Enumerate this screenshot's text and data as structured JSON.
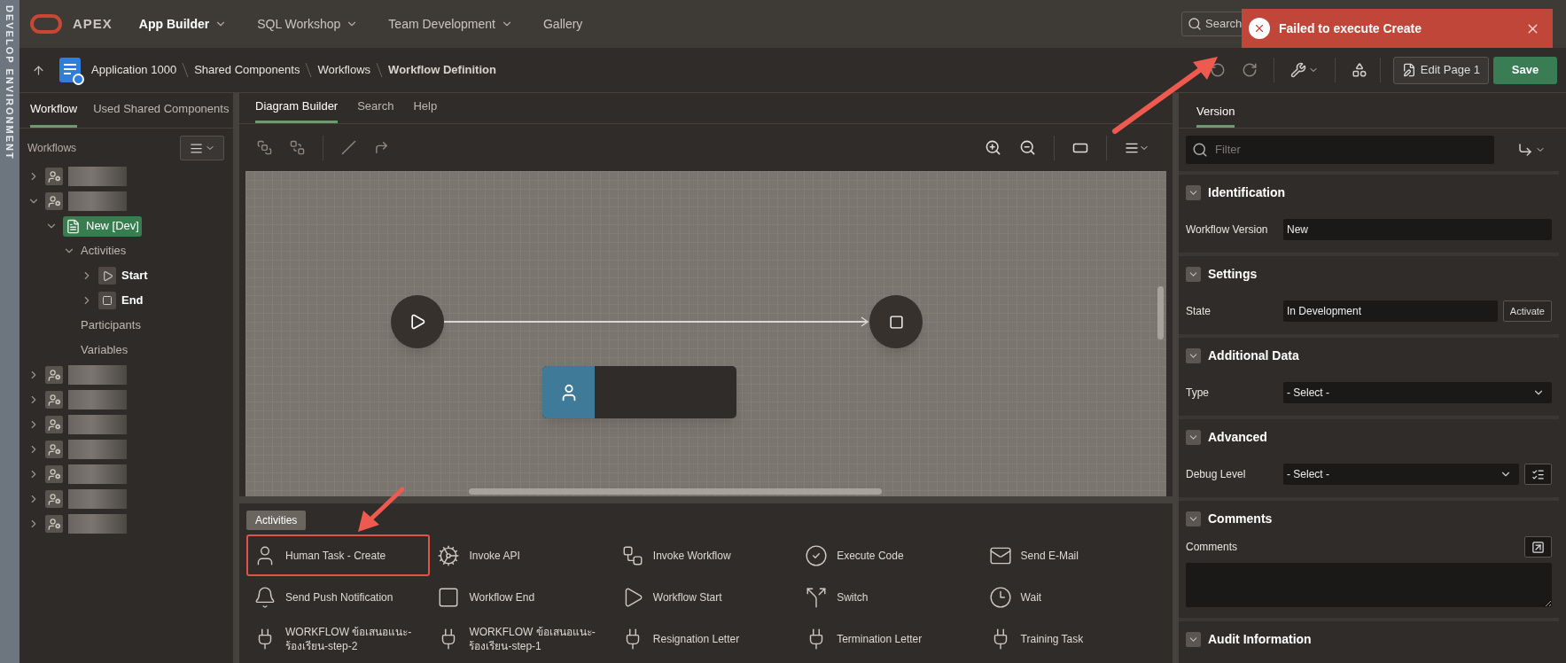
{
  "side_strip": {
    "label": "DEVELOP ENVIRONMENT"
  },
  "header": {
    "brand": "APEX",
    "nav": [
      {
        "label": "App Builder",
        "selected": true,
        "has_menu": true
      },
      {
        "label": "SQL Workshop",
        "selected": false,
        "has_menu": true
      },
      {
        "label": "Team Development",
        "selected": false,
        "has_menu": true
      },
      {
        "label": "Gallery",
        "selected": false,
        "has_menu": false
      }
    ],
    "search": {
      "placeholder": "Search"
    }
  },
  "toast": {
    "message": "Failed to execute Create"
  },
  "breadcrumb": [
    "Application 1000",
    "Shared Components",
    "Workflows",
    "Workflow Definition"
  ],
  "toolbar": {
    "edit_button": "Edit Page 1",
    "save_button": "Save"
  },
  "left_panel": {
    "tabs": [
      {
        "label": "Workflow",
        "selected": true
      },
      {
        "label": "Used Shared Components",
        "selected": false
      }
    ],
    "tree_title": "Workflows",
    "tree": [
      {
        "kind": "redacted",
        "expanded": false,
        "selected": false
      },
      {
        "kind": "redacted",
        "expanded": true,
        "selected": false,
        "children": [
          {
            "kind": "version",
            "label": "New [Dev]",
            "expanded": true,
            "selected": true,
            "children": [
              {
                "label": "Activities",
                "expanded": true,
                "selected": false,
                "children": [
                  {
                    "kind": "start",
                    "label": "Start",
                    "expanded": false,
                    "selected": false
                  },
                  {
                    "kind": "end",
                    "label": "End",
                    "expanded": false,
                    "selected": false
                  }
                ]
              },
              {
                "label": "Participants",
                "selected": false
              },
              {
                "label": "Variables",
                "selected": false
              }
            ]
          }
        ]
      },
      {
        "kind": "redacted",
        "expanded": false,
        "selected": false
      },
      {
        "kind": "redacted",
        "expanded": false,
        "selected": false
      },
      {
        "kind": "redacted",
        "expanded": false,
        "selected": false
      },
      {
        "kind": "redacted",
        "expanded": false,
        "selected": false
      },
      {
        "kind": "redacted",
        "expanded": false,
        "selected": false
      },
      {
        "kind": "redacted",
        "expanded": false,
        "selected": false
      },
      {
        "kind": "redacted",
        "expanded": false,
        "selected": false
      }
    ]
  },
  "center_tabs": [
    {
      "label": "Diagram Builder",
      "selected": true
    },
    {
      "label": "Search",
      "selected": false
    },
    {
      "label": "Help",
      "selected": false
    }
  ],
  "palette": {
    "group_label": "Activities",
    "items": [
      {
        "label": "Human Task - Create",
        "kind": "person",
        "highlighted": true
      },
      {
        "label": "Invoke API",
        "kind": "gear",
        "highlighted": false
      },
      {
        "label": "Invoke Workflow",
        "kind": "workflow",
        "highlighted": false
      },
      {
        "label": "Execute Code",
        "kind": "check",
        "highlighted": false
      },
      {
        "label": "Send E-Mail",
        "kind": "mail",
        "highlighted": false
      },
      {
        "label": "Send Push Notification",
        "kind": "bell",
        "highlighted": false
      },
      {
        "label": "Workflow End",
        "kind": "square",
        "highlighted": false
      },
      {
        "label": "Workflow Start",
        "kind": "play",
        "highlighted": false
      },
      {
        "label": "Switch",
        "kind": "switch",
        "highlighted": false
      },
      {
        "label": "Wait",
        "kind": "clock",
        "highlighted": false
      },
      {
        "label": "WORKFLOW ข้อเสนอแนะ-ร้องเรียน-step-2",
        "kind": "plug",
        "highlighted": false
      },
      {
        "label": "WORKFLOW ข้อเสนอแนะ-ร้องเรียน-step-1",
        "kind": "plug",
        "highlighted": false
      },
      {
        "label": "Resignation Letter",
        "kind": "plug",
        "highlighted": false
      },
      {
        "label": "Termination Letter",
        "kind": "plug",
        "highlighted": false
      },
      {
        "label": "Training Task",
        "kind": "plug",
        "highlighted": false
      }
    ]
  },
  "properties": {
    "tabs": [
      {
        "label": "Version",
        "selected": true
      }
    ],
    "filter": {
      "placeholder": "Filter"
    },
    "sections": [
      {
        "title": "Identification",
        "expanded": true,
        "fields": [
          {
            "label": "Workflow Version",
            "kind": "text",
            "value": "New"
          }
        ]
      },
      {
        "title": "Settings",
        "expanded": true,
        "fields": [
          {
            "label": "State",
            "kind": "text",
            "value": "In Development",
            "button": "Activate"
          }
        ]
      },
      {
        "title": "Additional Data",
        "expanded": true,
        "fields": [
          {
            "label": "Type",
            "kind": "select",
            "value": "- Select -"
          }
        ]
      },
      {
        "title": "Advanced",
        "expanded": true,
        "fields": [
          {
            "label": "Debug Level",
            "kind": "select",
            "value": "- Select -",
            "list_button": true
          }
        ]
      },
      {
        "title": "Comments",
        "expanded": true,
        "fields": [
          {
            "label": "Comments",
            "kind": "textarea"
          }
        ]
      },
      {
        "title": "Audit Information",
        "expanded": true
      }
    ]
  }
}
